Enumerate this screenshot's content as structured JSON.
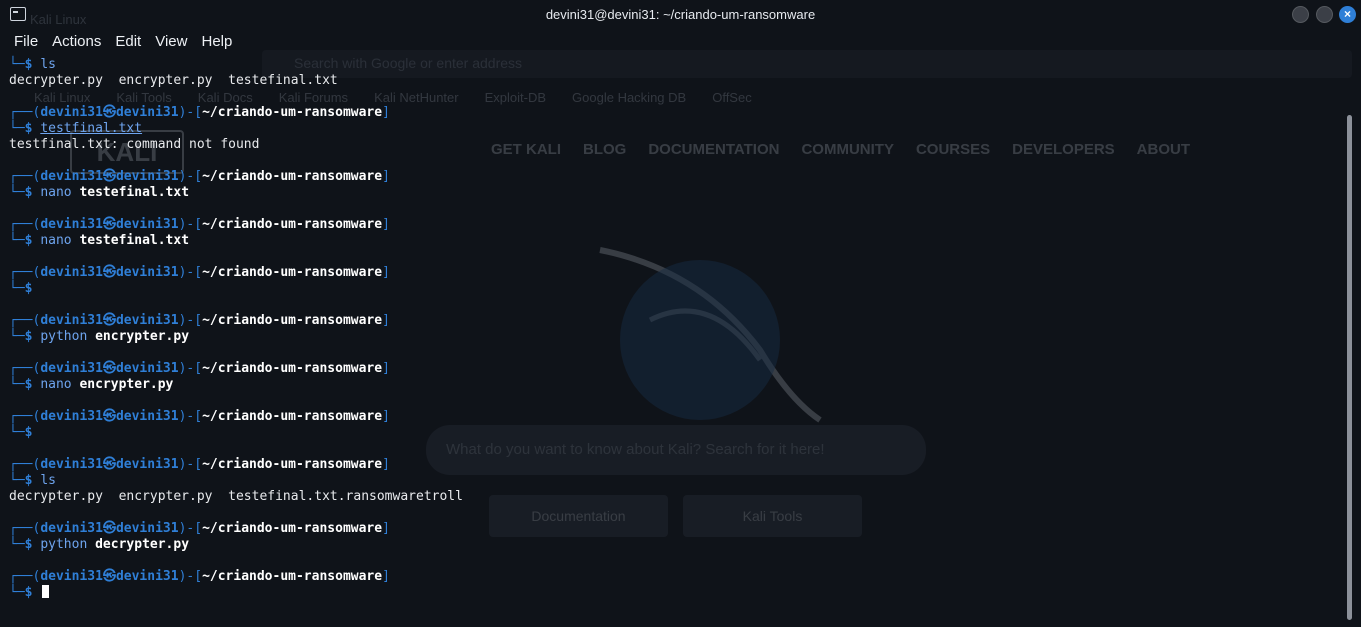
{
  "window": {
    "title": "devini31@devini31: ~/criando-um-ransomware"
  },
  "menu": {
    "file": "File",
    "actions": "Actions",
    "edit": "Edit",
    "view": "View",
    "help": "Help"
  },
  "prompt": {
    "user": "devini31",
    "host": "devini31",
    "at": "㉿",
    "path": "~/criando-um-ransomware",
    "dollar": "$"
  },
  "lines": {
    "l1_cmd": "ls",
    "l2_out": "decrypter.py  encrypter.py  testefinal.txt",
    "b1_cmd": "testfinal.txt",
    "b1_out": "testfinal.txt: command not found",
    "b2_cmd": "nano",
    "b2_arg": "testefinal.txt",
    "b3_cmd": "nano",
    "b3_arg": "testefinal.txt",
    "b5_cmd": "python",
    "b5_arg": "encrypter.py",
    "b6_cmd": "nano",
    "b6_arg": "encrypter.py",
    "b8_cmd": "ls",
    "b8_out": "decrypter.py  encrypter.py  testefinal.txt.ransomwaretroll",
    "b9_cmd": "python",
    "b9_arg": "decrypter.py"
  },
  "background": {
    "tab_title": "Kali Linux",
    "url_placeholder": "Search with Google or enter address",
    "bookmarks": [
      "Kali Linux",
      "Kali Tools",
      "Kali Docs",
      "Kali Forums",
      "Kali NetHunter",
      "Exploit-DB",
      "Google Hacking DB",
      "OffSec"
    ],
    "nav": [
      "GET KALI",
      "BLOG",
      "DOCUMENTATION",
      "COMMUNITY",
      "COURSES",
      "DEVELOPERS",
      "ABOUT"
    ],
    "logo_text": "KALI",
    "search_placeholder": "What do you want to know about Kali? Search for it here!",
    "btn_docs": "Documentation",
    "btn_tools": "Kali Tools"
  },
  "colors": {
    "accent": "#2f7fd7",
    "background": "#0f1319",
    "text": "#e8eaed"
  }
}
